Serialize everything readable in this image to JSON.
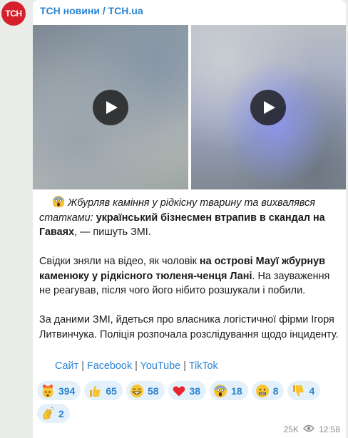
{
  "channel": {
    "avatar_text": "ТСН",
    "name": "ТСН новини / TCH.ua"
  },
  "post": {
    "p1_italic": "Жбурляв каміння у рідкісну тварину та вихвалявся статками:",
    "p1_bold": "український бізнесмен втрапив в скандал на Гаваях",
    "p1_tail": ", — пишуть ЗМІ.",
    "p2_a": "Свідки зняли на відео, як чоловік ",
    "p2_bold": "на острові Мауї жбурнув каменюку у рідкісного тюленя-ченця Лані",
    "p2_b": ". На зауваження не реагував, після чого його нібито розшукали і побили.",
    "p3": "За даними ЗМІ, йдеться про власника логістичної фірми Ігоря Литвинчука. Поліція розпочала розслідування щодо інциденту."
  },
  "links": {
    "site": "Сайт",
    "facebook": "Facebook",
    "youtube": "YouTube",
    "tiktok": "TikTok",
    "sep": "|"
  },
  "reactions": [
    {
      "icon": "exploding-head-icon",
      "count": "394"
    },
    {
      "icon": "thumbs-up-icon",
      "count": "65"
    },
    {
      "icon": "grinning-face-icon",
      "count": "58"
    },
    {
      "icon": "red-heart-icon",
      "count": "38"
    },
    {
      "icon": "screaming-face-icon",
      "count": "18"
    },
    {
      "icon": "grimacing-face-icon",
      "count": "8"
    },
    {
      "icon": "thumbs-down-icon",
      "count": "4"
    },
    {
      "icon": "clapping-hands-icon",
      "count": "2"
    }
  ],
  "meta": {
    "views": "25K",
    "time": "12:58"
  },
  "colors": {
    "link": "#2a84d0",
    "avatar": "#d6202b",
    "reaction_bg": "#e4f0fa"
  }
}
